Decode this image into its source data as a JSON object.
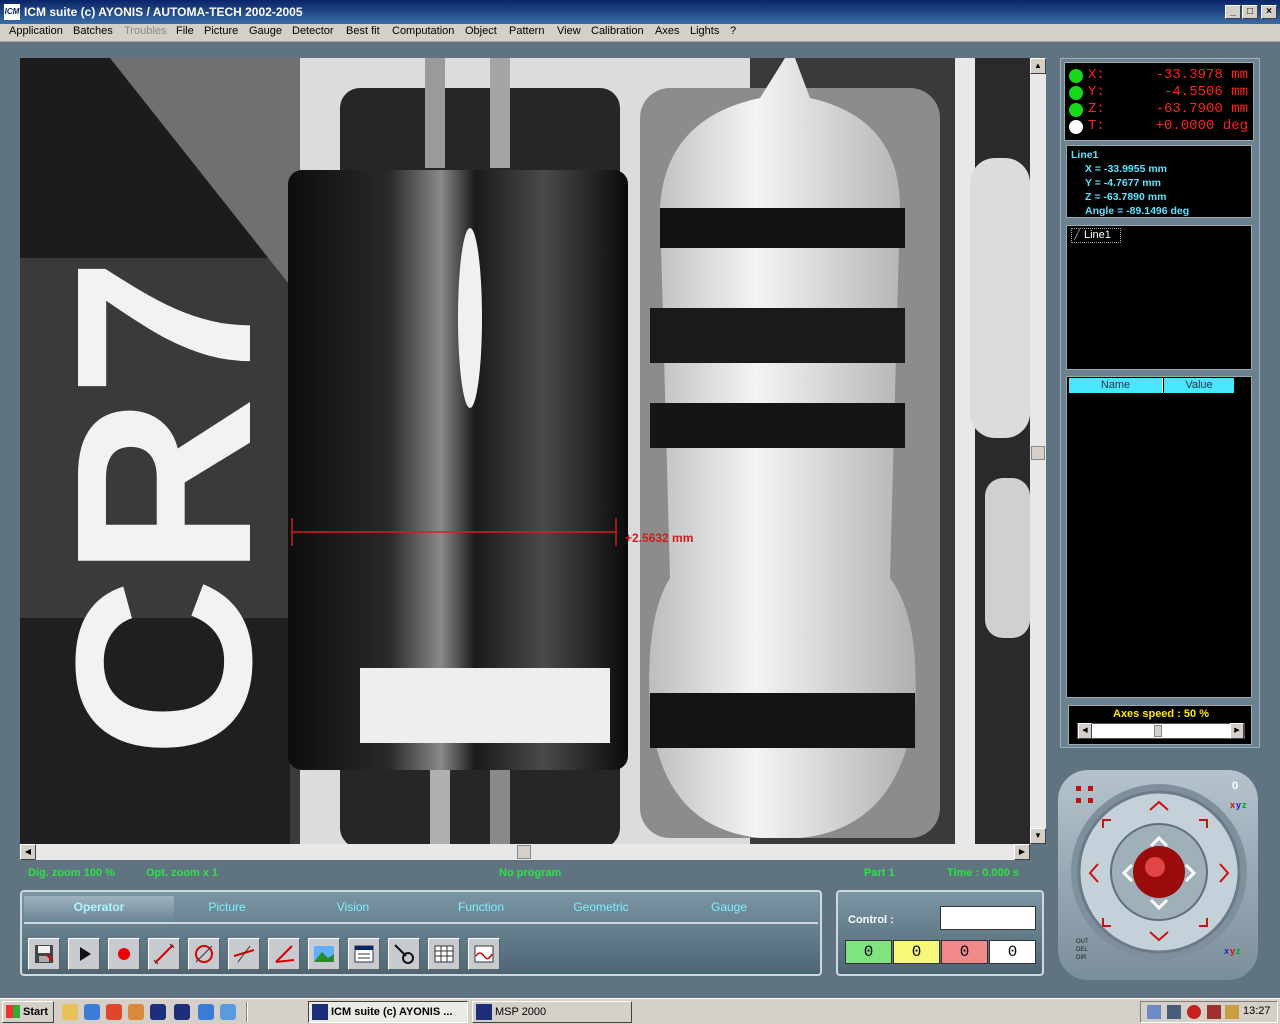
{
  "window": {
    "title": "ICM suite (c) AYONIS / AUTOMA-TECH 2002-2005",
    "app_icon_text": "ICM",
    "controls": [
      "_",
      "□",
      "×"
    ]
  },
  "menu": [
    "Application",
    "Batches",
    "Troubles",
    "File",
    "Picture",
    "Gauge",
    "Detector",
    "Best fit",
    "Computation",
    "Object",
    "Pattern",
    "View",
    "Calibration",
    "Axes",
    "Lights",
    "?"
  ],
  "menu_disabled": "Troubles",
  "viewport": {
    "image_text": "CR7",
    "measurement": "+2.5632 mm"
  },
  "status": {
    "dig_zoom": "Dig. zoom 100 %",
    "opt_zoom": "Opt. zoom x 1",
    "program": "No program",
    "part": "Part 1",
    "time": "Time : 0.000 s"
  },
  "tabs": [
    "Operator",
    "Picture",
    "Vision",
    "Function",
    "Geometric",
    "Gauge"
  ],
  "active_tab": "Operator",
  "tools": [
    "save-icon",
    "play-icon",
    "record-icon",
    "line-tool-icon",
    "circle-tool-icon",
    "distance-tool-icon",
    "angle-tool-icon",
    "image-icon",
    "window-icon",
    "probe-icon",
    "table-icon",
    "graph-icon"
  ],
  "control": {
    "label": "Control :",
    "input_value": "",
    "counters": [
      {
        "value": "0",
        "color": "#7fe37f"
      },
      {
        "value": "0",
        "color": "#f7f77a"
      },
      {
        "value": "0",
        "color": "#f08a8a"
      },
      {
        "value": "0",
        "color": "#ffffff"
      }
    ]
  },
  "coords": [
    {
      "label": "X:",
      "value": "-33.3978 mm",
      "dot": "#18d818"
    },
    {
      "label": "Y:",
      "value": "-4.5506 mm",
      "dot": "#18d818"
    },
    {
      "label": "Z:",
      "value": "-63.7900 mm",
      "dot": "#18d818"
    },
    {
      "label": "T:",
      "value": "+0.0000 deg",
      "dot": "#ffffff"
    }
  ],
  "line_info": {
    "name": "Line1",
    "x": "X = -33.9955 mm",
    "y": "Y = -4.7677 mm",
    "z": "Z = -63.7890 mm",
    "angle": "Angle = -89.1496 deg"
  },
  "object_list": [
    "Line1"
  ],
  "property_table": {
    "headers": [
      "Name",
      "Value"
    ]
  },
  "axes_speed": {
    "label": "Axes speed : 50 %",
    "percent": 50
  },
  "joystick": {
    "top_number": "0",
    "labels": [
      "OUT",
      "DEL",
      "DIR"
    ]
  },
  "taskbar": {
    "start": "Start",
    "tasks": [
      "ICM suite (c) AYONIS ...",
      "MSP 2000"
    ],
    "clock": "13:27"
  }
}
